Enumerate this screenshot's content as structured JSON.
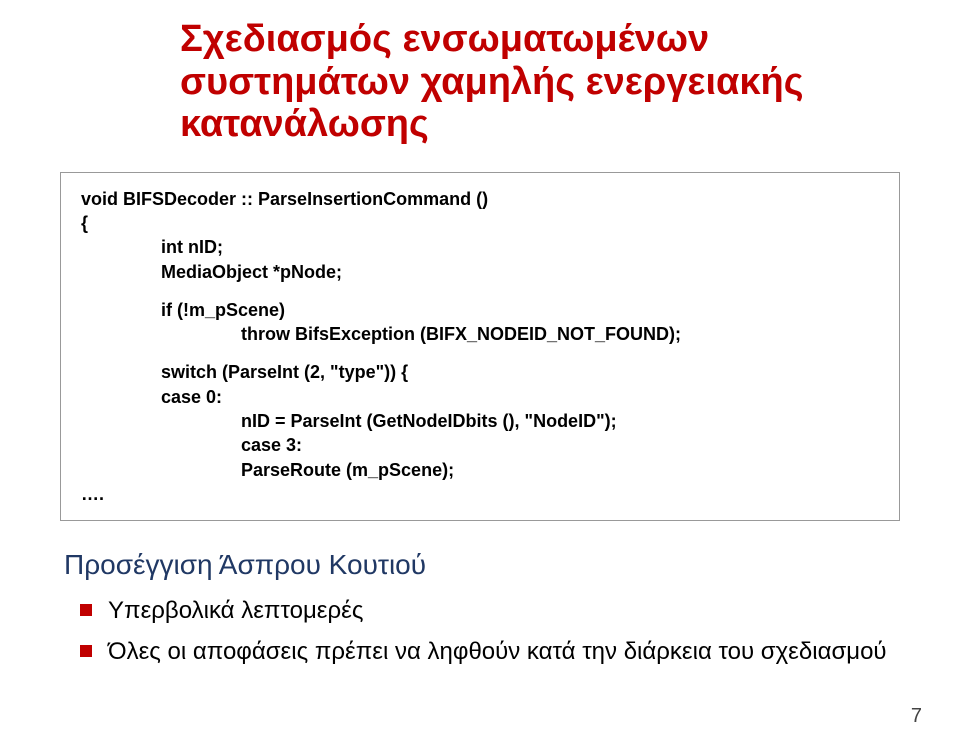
{
  "title_line1": "Σχεδιασμός ενσωματωμένων",
  "title_line2": "συστημάτων χαμηλής ενεργειακής",
  "title_line3": "κατανάλωσης",
  "code": {
    "l1": "void BIFSDecoder :: ParseInsertionCommand ()",
    "l2": "{",
    "l3": "int nID;",
    "l4": "MediaObject *pNode;",
    "l5": "if (!m_pScene)",
    "l6": "throw BifsException (BIFX_NODEID_NOT_FOUND);",
    "l7": "switch (ParseInt (2, \"type\")) {",
    "l8": "case 0:",
    "l9": "nID = ParseInt (GetNodeIDbits (), \"NodeID\");",
    "l10": "case 3:",
    "l11": "ParseRoute (m_pScene);",
    "l12": "…."
  },
  "subhead": "Προσέγγιση Άσπρου Κουτιού",
  "bullets": [
    "Υπερβολικά λεπτομερές",
    "Όλες οι αποφάσεις πρέπει να ληφθούν κατά την διάρκεια του σχεδιασμού"
  ],
  "page_number": "7"
}
